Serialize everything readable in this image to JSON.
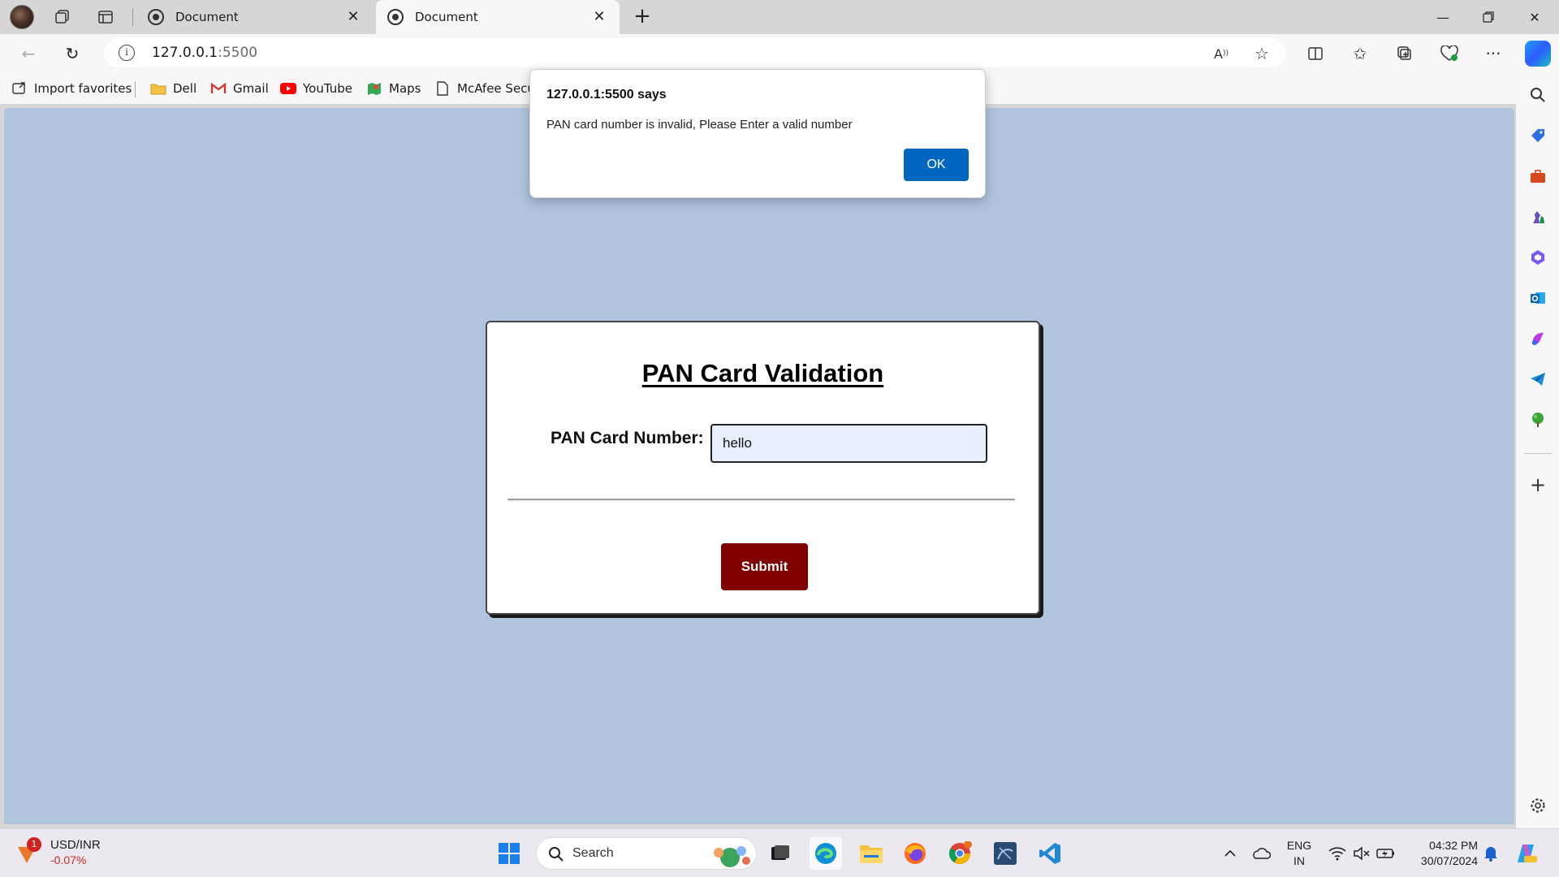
{
  "browser": {
    "tabs": [
      {
        "title": "Document",
        "active": false
      },
      {
        "title": "Document",
        "active": true
      }
    ],
    "address": {
      "host": "127.0.0.1",
      "port": ":5500"
    },
    "favorites": [
      {
        "label": "Import favorites",
        "icon": "import-icon"
      },
      {
        "label": "Dell",
        "icon": "folder-icon"
      },
      {
        "label": "Gmail",
        "icon": "gmail-icon"
      },
      {
        "label": "YouTube",
        "icon": "youtube-icon"
      },
      {
        "label": "Maps",
        "icon": "maps-icon"
      },
      {
        "label": "McAfee Secur",
        "icon": "document-icon"
      }
    ]
  },
  "dialog": {
    "title": "127.0.0.1:5500 says",
    "message": "PAN card number is invalid, Please Enter a valid number",
    "ok_label": "OK",
    "accent": "#0067c0"
  },
  "page": {
    "background": "#b0c4de",
    "title": "PAN Card Validation",
    "field_label": "PAN Card Number:",
    "field_value": "hello",
    "submit_label": "Submit",
    "submit_color": "#800000"
  },
  "taskbar": {
    "ticker": {
      "symbol": "USD/INR",
      "change": "-0.07%",
      "badge": "1"
    },
    "search_placeholder": "Search",
    "lang_line1": "ENG",
    "lang_line2": "IN",
    "time": "04:32 PM",
    "date": "30/07/2024"
  }
}
